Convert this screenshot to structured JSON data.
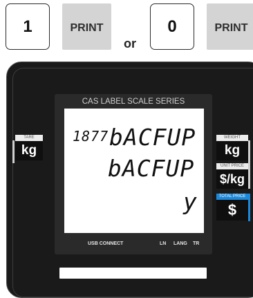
{
  "keys": {
    "key1_label": "1",
    "print1_label": "PRINT",
    "or_text": "or",
    "key0_label": "0",
    "print2_label": "PRINT"
  },
  "scale": {
    "display_title": "CAS LABEL SCALE SERIES",
    "lcd": {
      "code": "1877",
      "line1": "bACFUP",
      "line2": "bACFUP",
      "line3": "y"
    },
    "footer": {
      "usb": "USB CONNECT",
      "ln": "LN",
      "lang": "LANG",
      "tr": "TR"
    },
    "left": {
      "tare_tab": "TARE",
      "tare_unit": "kg"
    },
    "right": {
      "weight_tab": "WEIGHT",
      "weight_unit": "kg",
      "unit_price_tab": "UNIT PRICE",
      "unit_price_unit": "$/kg",
      "total_price_tab": "TOTAL PRICE",
      "total_price_unit": "$"
    }
  },
  "colors": {
    "body": "#1a1a1a",
    "print_key": "#d4d4d4",
    "total_price_accent": "#1e88d8"
  }
}
